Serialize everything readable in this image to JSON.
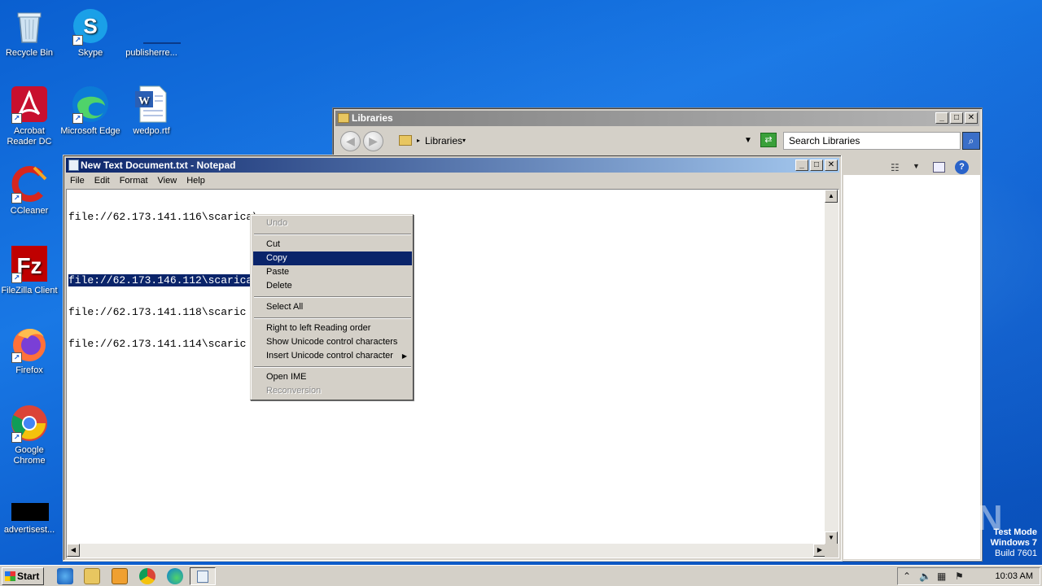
{
  "desktop": {
    "icons": [
      {
        "label": "Recycle Bin"
      },
      {
        "label": "Skype"
      },
      {
        "label": "publisherre..."
      },
      {
        "label": "Acrobat Reader DC"
      },
      {
        "label": "Microsoft Edge"
      },
      {
        "label": "wedpo.rtf"
      },
      {
        "label": "CCleaner"
      },
      {
        "label": "FileZilla Client"
      },
      {
        "label": "Firefox"
      },
      {
        "label": "Google Chrome"
      },
      {
        "label": "advertisest..."
      }
    ]
  },
  "libraries_window": {
    "title": "Libraries",
    "address": "Libraries",
    "search_placeholder": "Search Libraries"
  },
  "notepad": {
    "title": "New Text Document.txt - Notepad",
    "menu": [
      "File",
      "Edit",
      "Format",
      "View",
      "Help"
    ],
    "lines": [
      "file://62.173.141.116\\scarica\\",
      "",
      "file://62.173.146.112\\scarica",
      "file://62.173.141.118\\scaric",
      "file://62.173.141.114\\scaric"
    ]
  },
  "context_menu": {
    "items": [
      {
        "label": "Undo",
        "state": "disabled"
      },
      {
        "label": "Cut",
        "state": "enabled"
      },
      {
        "label": "Copy",
        "state": "highlighted"
      },
      {
        "label": "Paste",
        "state": "enabled"
      },
      {
        "label": "Delete",
        "state": "enabled"
      },
      {
        "label": "Select All",
        "state": "enabled"
      },
      {
        "label": "Right to left Reading order",
        "state": "enabled"
      },
      {
        "label": "Show Unicode control characters",
        "state": "enabled"
      },
      {
        "label": "Insert Unicode control character",
        "state": "enabled"
      },
      {
        "label": "Open IME",
        "state": "enabled"
      },
      {
        "label": "Reconversion",
        "state": "disabled"
      }
    ]
  },
  "watermark": "ANY RUN",
  "test_mode": {
    "line1": "Test Mode",
    "line2": "Windows 7",
    "line3": "Build 7601"
  },
  "taskbar": {
    "start_label": "Start",
    "clock": "10:03 AM"
  }
}
